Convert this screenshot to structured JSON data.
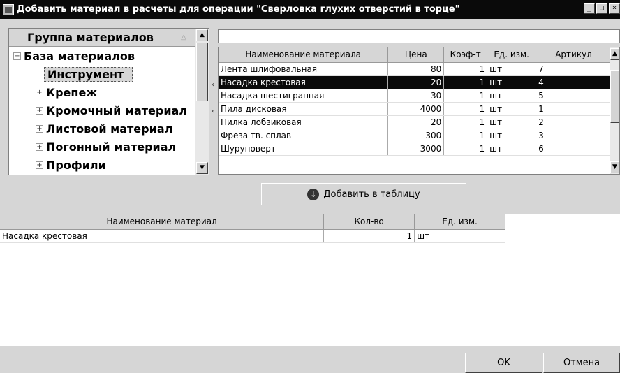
{
  "window": {
    "title": "Добавить материал в расчеты для операции \"Сверловка глухих отверстий в торце\"",
    "buttons": [
      "_",
      "□",
      "×"
    ]
  },
  "tree": {
    "header": "Группа материалов",
    "root": "База материалов",
    "items": [
      {
        "label": "Инструмент",
        "expander": ""
      },
      {
        "label": "Крепеж",
        "expander": "+"
      },
      {
        "label": "Кромочный материал",
        "expander": "+"
      },
      {
        "label": "Листовой материал",
        "expander": "+"
      },
      {
        "label": "Погонный материал",
        "expander": "+"
      },
      {
        "label": "Профили",
        "expander": "+"
      }
    ]
  },
  "materials": {
    "search_value": "",
    "columns": [
      "Наименование материала",
      "Цена",
      "Коэф-т",
      "Ед. изм.",
      "Артикул"
    ],
    "rows": [
      [
        "Лента шлифовальная",
        "80",
        "1",
        "шт",
        "7"
      ],
      [
        "Насадка крестовая",
        "20",
        "1",
        "шт",
        "4"
      ],
      [
        "Насадка шестигранная",
        "30",
        "1",
        "шт",
        "5"
      ],
      [
        "Пила дисковая",
        "4000",
        "1",
        "шт",
        "1"
      ],
      [
        "Пилка лобзиковая",
        "20",
        "1",
        "шт",
        "2"
      ],
      [
        "Фреза тв. сплав",
        "300",
        "1",
        "шт",
        "3"
      ],
      [
        "Шуруповерт",
        "3000",
        "1",
        "шт",
        "6"
      ]
    ],
    "selected_index": 1
  },
  "add_button": {
    "label": "Добавить в таблицу",
    "icon": "arrow-down-circle-icon"
  },
  "selected_materials": {
    "columns": [
      "Наименование материал",
      "Кол-во",
      "Ед. изм."
    ],
    "rows": [
      [
        "Насадка крестовая",
        "1",
        "шт"
      ]
    ]
  },
  "footer": {
    "ok": "OK",
    "cancel": "Отмена"
  },
  "colors": {
    "titlebar": "#0a0a0a",
    "selection": "#0a0a0a",
    "panel": "#d6d6d6"
  }
}
